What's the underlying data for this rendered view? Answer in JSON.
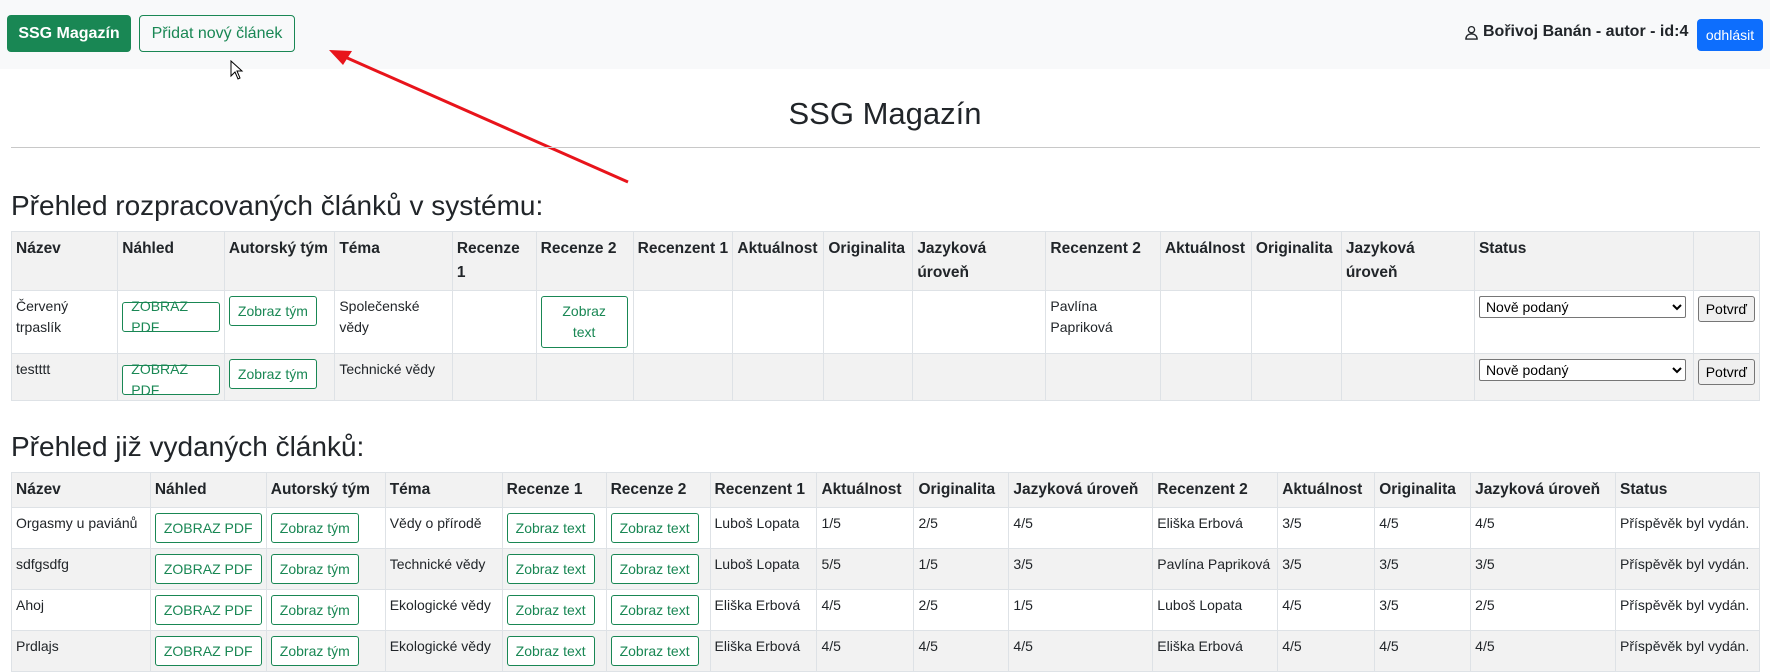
{
  "header": {
    "brand": "SSG Magazín",
    "new_article": "Přidat nový článek",
    "user": "Bořivoj Banán - autor - id:4",
    "logout": "odhlásit"
  },
  "page_title": "SSG Magazín",
  "pending": {
    "heading": "Přehled rozpracovaných článků v systému:",
    "columns": [
      "Název",
      "Náhled",
      "Autorský tým",
      "Téma",
      "Recenze 1",
      "Recenze 2",
      "Recenzent 1",
      "Aktuálnost",
      "Originalita",
      "Jazyková úroveň",
      "Recenzent 2",
      "Aktuálnost",
      "Originalita",
      "Jazyková úroveň",
      "Status",
      ""
    ],
    "rows": [
      {
        "name": "Červený trpaslík",
        "preview": "ZOBRAZ PDF",
        "team": "Zobraz tým",
        "topic": "Společenské vědy",
        "review2": "Zobraz text",
        "reviewer2": "Pavlína Papriková",
        "status": "Nově podaný",
        "confirm": "Potvrď"
      },
      {
        "name": "testttt",
        "preview": "ZOBRAZ PDF",
        "team": "Zobraz tým",
        "topic": "Technické vědy",
        "status": "Nově podaný",
        "confirm": "Potvrď"
      }
    ]
  },
  "published": {
    "heading": "Přehled již vydaných článků:",
    "columns": [
      "Název",
      "Náhled",
      "Autorský tým",
      "Téma",
      "Recenze 1",
      "Recenze 2",
      "Recenzent 1",
      "Aktuálnost",
      "Originalita",
      "Jazyková úroveň",
      "Recenzent 2",
      "Aktuálnost",
      "Originalita",
      "Jazyková úroveň",
      "Status"
    ],
    "rows": [
      {
        "name": "Orgasmy u paviánů",
        "preview": "ZOBRAZ PDF",
        "team": "Zobraz tým",
        "topic": "Vědy o přírodě",
        "review1": "Zobraz text",
        "review2": "Zobraz text",
        "reviewer1": "Luboš Lopata",
        "a1": "1/5",
        "o1": "2/5",
        "j1": "4/5",
        "reviewer2": "Eliška Erbová",
        "a2": "3/5",
        "o2": "4/5",
        "j2": "4/5",
        "status": "Příspěvěk byl vydán."
      },
      {
        "name": "sdfgsdfg",
        "preview": "ZOBRAZ PDF",
        "team": "Zobraz tým",
        "topic": "Technické vědy",
        "review1": "Zobraz text",
        "review2": "Zobraz text",
        "reviewer1": "Luboš Lopata",
        "a1": "5/5",
        "o1": "1/5",
        "j1": "3/5",
        "reviewer2": "Pavlína Papriková",
        "a2": "3/5",
        "o2": "3/5",
        "j2": "3/5",
        "status": "Příspěvěk byl vydán."
      },
      {
        "name": "Ahoj",
        "preview": "ZOBRAZ PDF",
        "team": "Zobraz tým",
        "topic": "Ekologické vědy",
        "review1": "Zobraz text",
        "review2": "Zobraz text",
        "reviewer1": "Eliška Erbová",
        "a1": "4/5",
        "o1": "2/5",
        "j1": "1/5",
        "reviewer2": "Luboš Lopata",
        "a2": "4/5",
        "o2": "3/5",
        "j2": "2/5",
        "status": "Příspěvěk byl vydán."
      },
      {
        "name": "Prdlajs",
        "preview": "ZOBRAZ PDF",
        "team": "Zobraz tým",
        "topic": "Ekologické vědy",
        "review1": "Zobraz text",
        "review2": "Zobraz text",
        "reviewer1": "Eliška Erbová",
        "a1": "4/5",
        "o1": "4/5",
        "j1": "4/5",
        "reviewer2": "Eliška Erbová",
        "a2": "4/5",
        "o2": "4/5",
        "j2": "4/5",
        "status": "Příspěvěk byl vydán."
      }
    ]
  },
  "colors": {
    "brand_green": "#198754",
    "logout_blue": "#0d6efd",
    "arrow_red": "#e8141b"
  }
}
